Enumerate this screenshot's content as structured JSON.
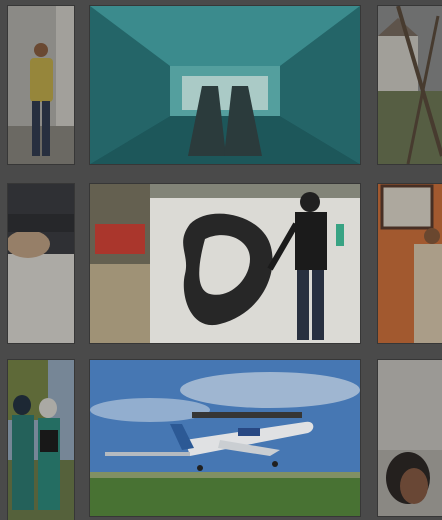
{
  "gallery": {
    "background": "#4a4a4a",
    "tiles": [
      {
        "name": "photo-man-portrait",
        "subject": "man-in-yellow-shirt-icon"
      },
      {
        "name": "photo-escalator-tunnel",
        "subject": "escalator-icon"
      },
      {
        "name": "photo-house-sculpture",
        "subject": "house-icon"
      },
      {
        "name": "photo-seated-people",
        "subject": "people-icon"
      },
      {
        "name": "photo-graffiti-artist",
        "subject": "painter-icon"
      },
      {
        "name": "photo-orange-room",
        "subject": "person-icon"
      },
      {
        "name": "photo-women-outdoors",
        "subject": "women-icon"
      },
      {
        "name": "photo-airplane-takeoff",
        "subject": "airplane-icon"
      },
      {
        "name": "photo-woman-profile",
        "subject": "woman-icon"
      }
    ]
  }
}
